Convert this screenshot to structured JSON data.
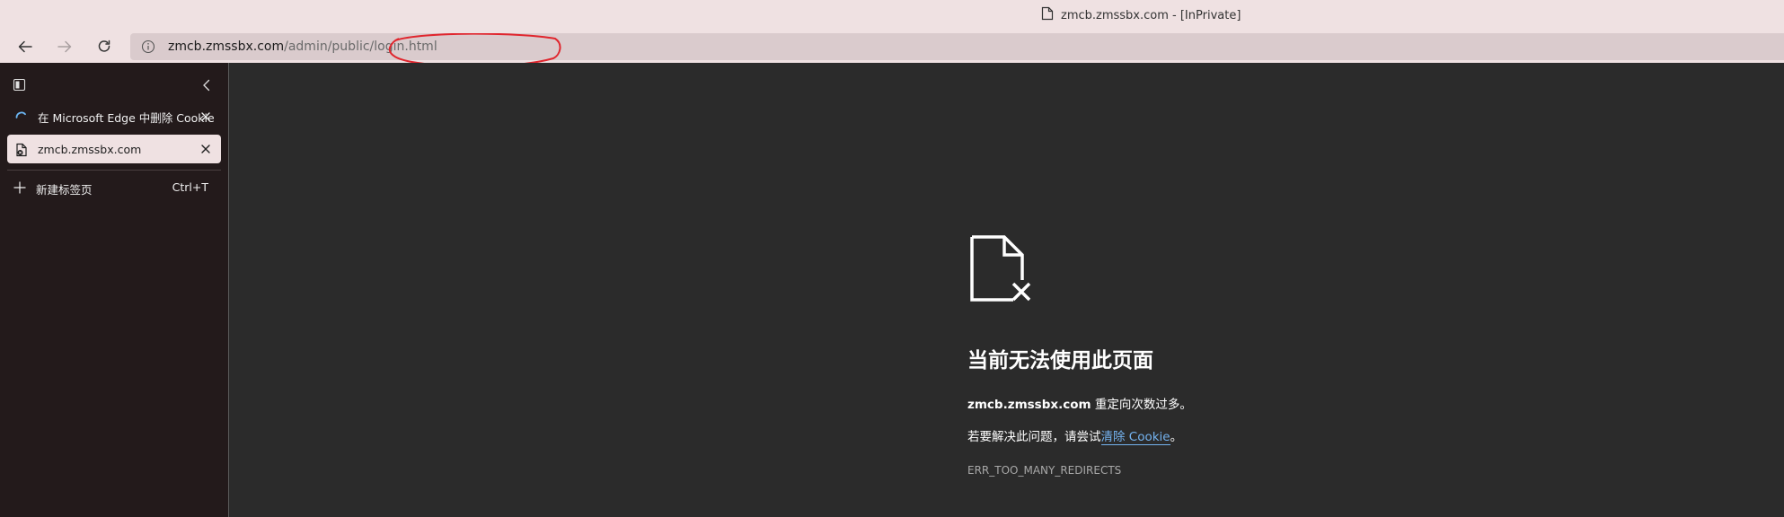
{
  "window": {
    "title": "zmcb.zmssbx.com - [InPrivate]"
  },
  "toolbar": {
    "back_icon": "arrow-left-icon",
    "forward_icon": "arrow-right-icon",
    "refresh_icon": "refresh-icon"
  },
  "address_bar": {
    "host": "zmcb.zmssbx.com",
    "path": "/admin/public/login.html",
    "annotation_color": "#e0262e"
  },
  "sidebar": {
    "tabs": [
      {
        "label": "在 Microsoft Edge 中删除 Cookie",
        "icon": "loading-spinner-icon",
        "active": false
      },
      {
        "label": "zmcb.zmssbx.com",
        "icon": "page-icon",
        "active": true
      }
    ],
    "new_tab": {
      "label": "新建标签页",
      "shortcut": "Ctrl+T"
    }
  },
  "error_page": {
    "icon": "broken-document-icon",
    "title": "当前无法使用此页面",
    "host": "zmcb.zmssbx.com",
    "message": " 重定向次数过多。",
    "hint_prefix": "若要解决此问题，请尝试",
    "hint_link": "清除 Cookie",
    "hint_suffix": "。",
    "code": "ERR_TOO_MANY_REDIRECTS",
    "link_color": "#74b3f0"
  }
}
